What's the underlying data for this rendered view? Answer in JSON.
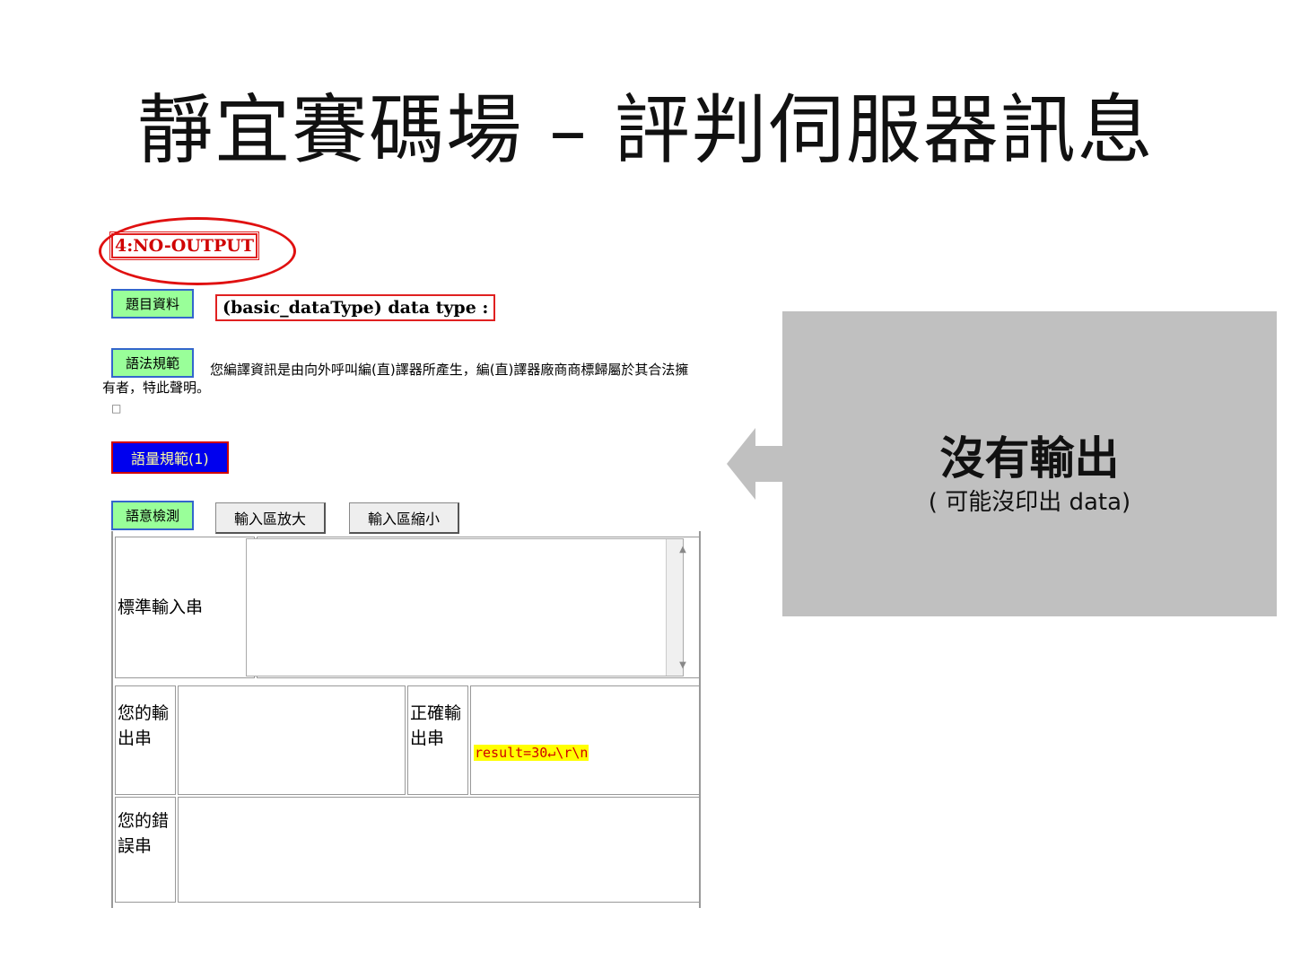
{
  "slide": {
    "title": "靜宜賽碼場 – 評判伺服器訊息"
  },
  "judge": {
    "status": "4:NO-OUTPUT",
    "problem_info_label": "題目資料",
    "problem_type": "(basic_dataType) data type :",
    "syntax_label": "語法規範",
    "compiler_message": "您編譯資訊是由向外呼叫編(直)譯器所產生，編(直)譯器廠商商標歸屬於其合法擁有者，特此聲明。",
    "checkbox_glyph": "□",
    "lexical_label": "語量規範(1)",
    "semantic_label": "語意檢測",
    "enlarge_label": "輸入區放大",
    "shrink_label": "輸入區縮小",
    "stdin_label": "標準輸入串",
    "your_output_label": "您的輸出串",
    "expected_output_label": "正確輸出串",
    "expected_output_value": "result=30↵\\r\\n",
    "your_error_label": "您的錯誤串"
  },
  "callout": {
    "title": "沒有輸出",
    "subtitle": "( 可能沒印出 data)"
  }
}
